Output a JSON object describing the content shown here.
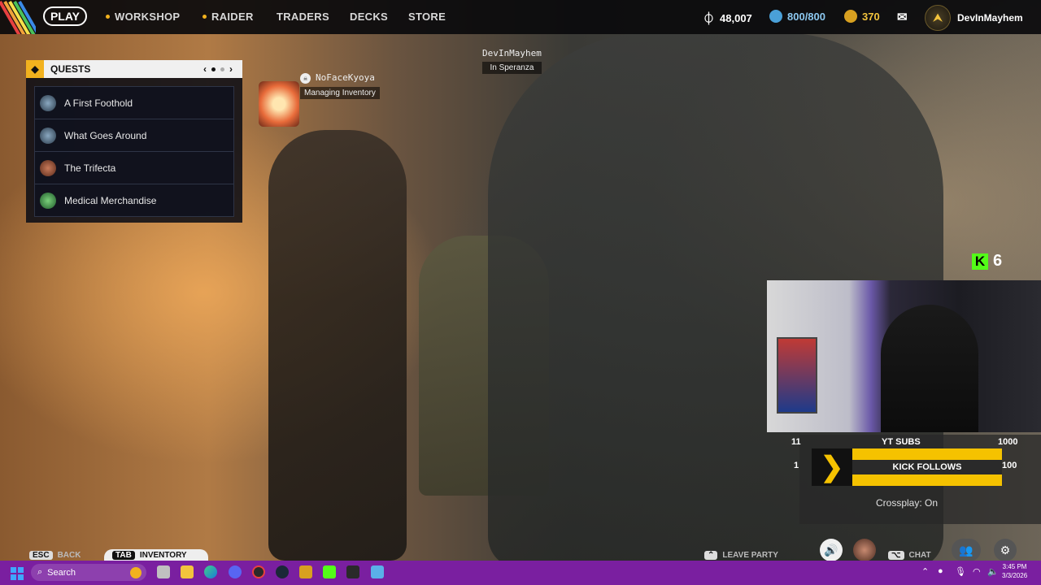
{
  "nav": {
    "play": "PLAY",
    "items": [
      {
        "label": "WORKSHOP",
        "dot": true
      },
      {
        "label": "RAIDER",
        "dot": true
      },
      {
        "label": "TRADERS",
        "dot": false
      },
      {
        "label": "DECKS",
        "dot": false
      },
      {
        "label": "STORE",
        "dot": false
      }
    ],
    "currency_coins": "48,007",
    "currency_energy": "800/800",
    "currency_raider": "370",
    "username": "DevInMayhem"
  },
  "quests": {
    "title": "QUESTS",
    "prev": "‹",
    "next": "›",
    "items": [
      {
        "label": "A First Foothold",
        "color": "#3a5a78"
      },
      {
        "label": "What Goes Around",
        "color": "#3a5a78"
      },
      {
        "label": "The Trifecta",
        "color": "#8a3a2a"
      },
      {
        "label": "Medical Merchandise",
        "color": "#2f8a3a"
      }
    ]
  },
  "players": [
    {
      "name": "NoFaceKyoya",
      "status": "Managing Inventory"
    },
    {
      "name": "DevInMayhem",
      "status": "In Speranza"
    }
  ],
  "overlay": {
    "kick_count": "6",
    "yt_left": "11",
    "yt_label": "YT SUBS",
    "yt_goal": "1000",
    "kick_left": "1",
    "kick_label": "KICK FOLLOWS",
    "kick_goal": "100",
    "crossplay": "Crossplay: On"
  },
  "hints": {
    "esc_key": "ESC",
    "back": "BACK",
    "tab_key": "TAB",
    "inventory": "INVENTORY",
    "leave_party": "LEAVE PARTY",
    "chat": "CHAT"
  },
  "taskbar": {
    "search": "Search",
    "time": "3:45 PM",
    "date": "3/3/2026"
  },
  "colors": {
    "accent": "#f2b21e",
    "taskbar": "#7a1fa0",
    "kick": "#53fc18"
  }
}
